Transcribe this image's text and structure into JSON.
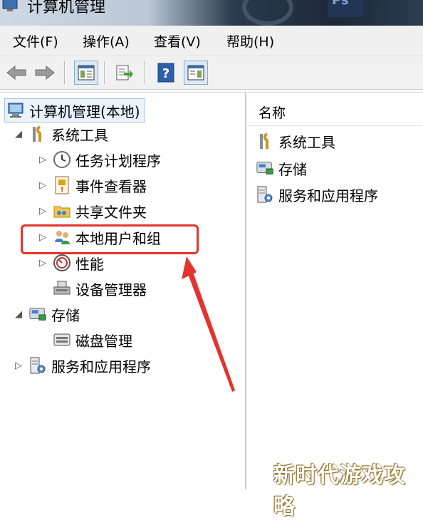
{
  "window": {
    "title": "计算机管理"
  },
  "menu": {
    "file": "文件(F)",
    "action": "操作(A)",
    "view": "查看(V)",
    "help": "帮助(H)"
  },
  "tree": {
    "root": "计算机管理(本地)",
    "system_tools": "系统工具",
    "task_scheduler": "任务计划程序",
    "event_viewer": "事件查看器",
    "shared_folders": "共享文件夹",
    "local_users_groups": "本地用户和组",
    "performance": "性能",
    "device_manager": "设备管理器",
    "storage": "存储",
    "disk_management": "磁盘管理",
    "services_apps": "服务和应用程序"
  },
  "right_pane": {
    "column_name": "名称",
    "items": [
      "系统工具",
      "存储",
      "服务和应用程序"
    ]
  },
  "watermark": "新时代游戏攻略",
  "colors": {
    "highlight": "#e5322d",
    "selection_bg": "#eaf2fb"
  }
}
